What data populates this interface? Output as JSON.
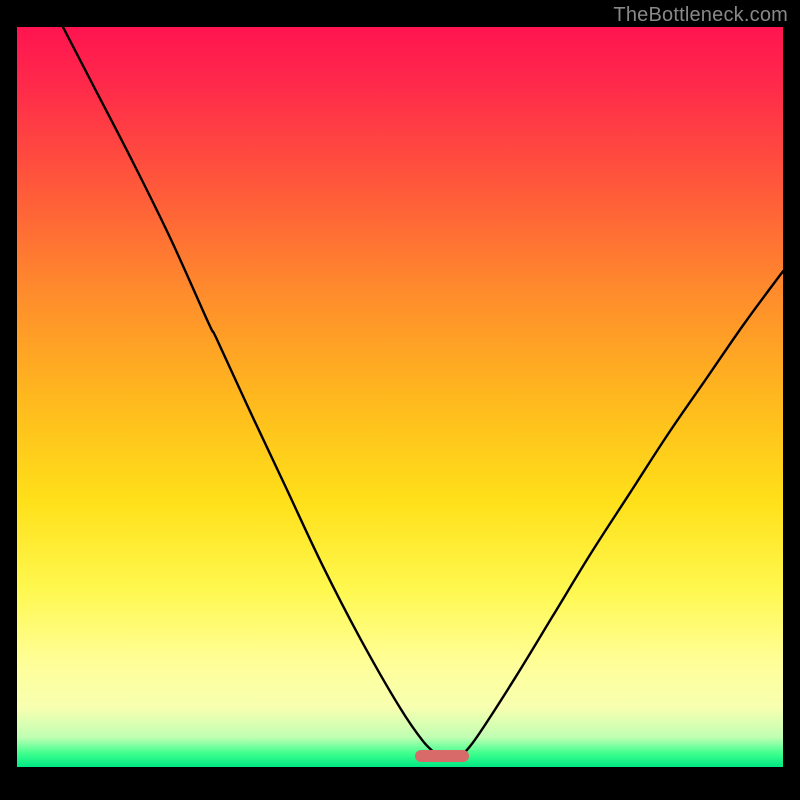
{
  "watermark": "TheBottleneck.com",
  "colors": {
    "frame": "#000000",
    "gradient_top": "#ff1450",
    "gradient_mid": "#ffe019",
    "gradient_bottom": "#00e884",
    "curve": "#000000",
    "marker": "#d96a6a"
  },
  "plot": {
    "x_range": [
      0,
      100
    ],
    "y_range": [
      0,
      100
    ],
    "marker": {
      "x_center": 55.5,
      "width_pct": 7,
      "y": 1.5
    }
  },
  "chart_data": {
    "type": "line",
    "title": "",
    "xlabel": "",
    "ylabel": "",
    "xlim": [
      0,
      100
    ],
    "ylim": [
      0,
      100
    ],
    "series": [
      {
        "name": "left-branch",
        "x": [
          6,
          10,
          15,
          20,
          25,
          26,
          30,
          35,
          40,
          45,
          50,
          53,
          55
        ],
        "values": [
          100,
          92,
          82,
          71.5,
          60,
          58,
          49,
          38,
          27,
          17,
          8,
          3.5,
          1.5
        ]
      },
      {
        "name": "right-branch",
        "x": [
          58,
          60,
          65,
          70,
          75,
          80,
          85,
          90,
          95,
          100
        ],
        "values": [
          1.5,
          4,
          12,
          20.5,
          29,
          37,
          45,
          52.5,
          60,
          67
        ]
      }
    ],
    "annotations": [
      {
        "type": "marker",
        "shape": "pill",
        "x_start": 52,
        "x_end": 59,
        "y": 1.5
      }
    ]
  }
}
